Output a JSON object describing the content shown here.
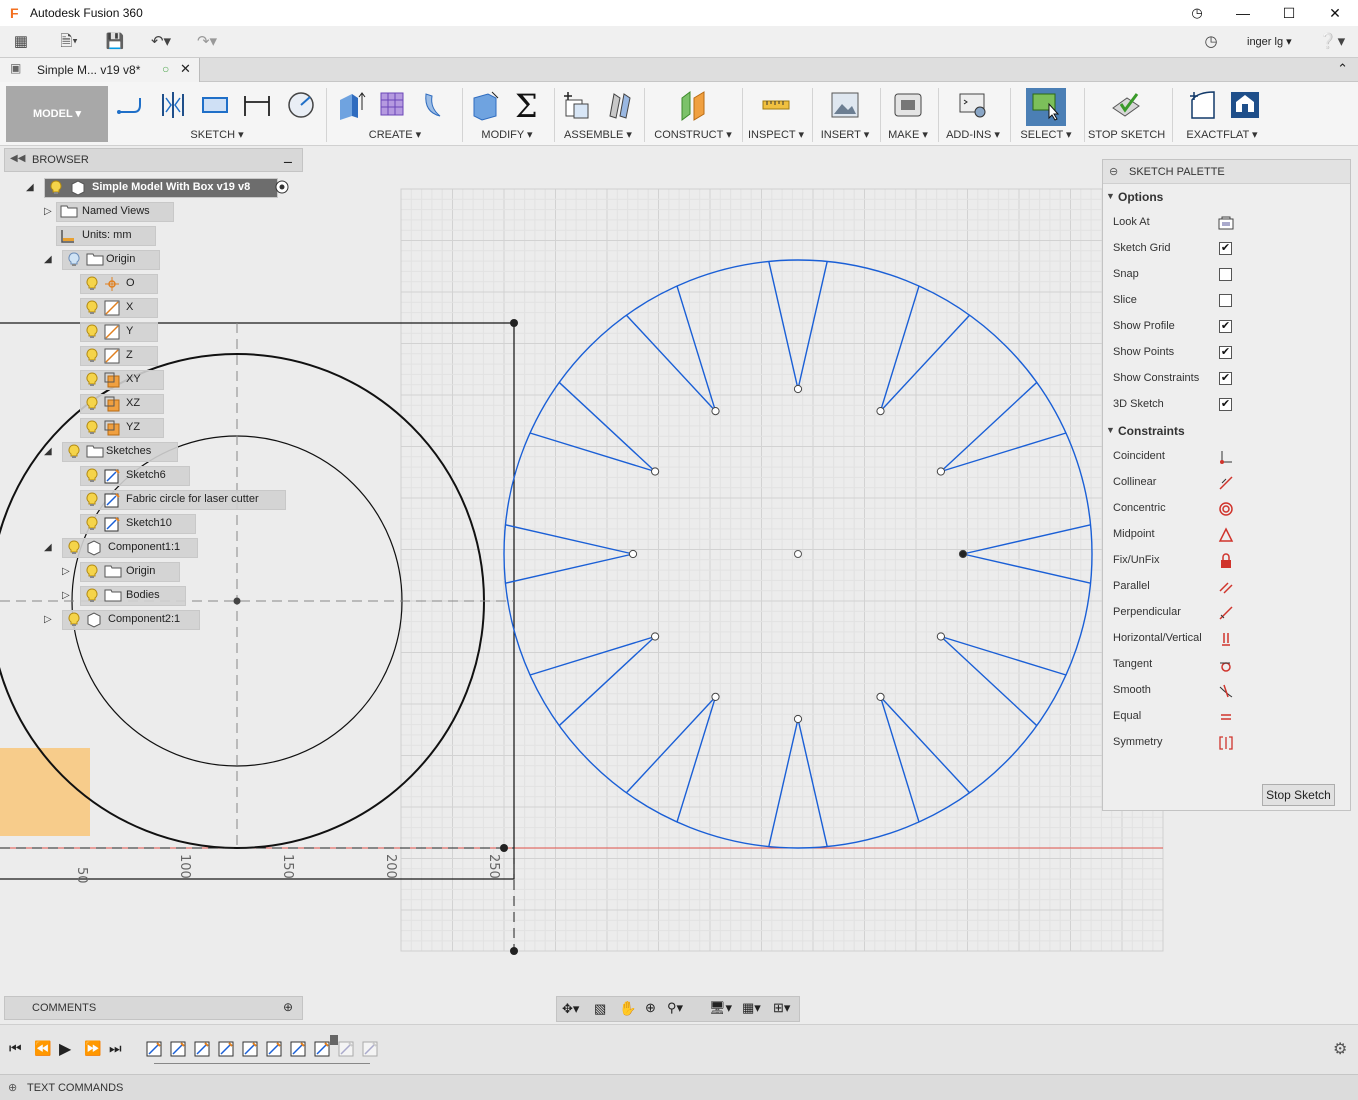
{
  "app": {
    "title": "Autodesk Fusion 360",
    "user": "inger lg"
  },
  "document_tab": {
    "label": "Simple M... v19 v8*"
  },
  "toolbar": {
    "workspace": "MODEL",
    "groups": [
      {
        "label": "SKETCH"
      },
      {
        "label": "CREATE"
      },
      {
        "label": "MODIFY"
      },
      {
        "label": "ASSEMBLE"
      },
      {
        "label": "CONSTRUCT"
      },
      {
        "label": "INSPECT"
      },
      {
        "label": "INSERT"
      },
      {
        "label": "MAKE"
      },
      {
        "label": "ADD-INS"
      },
      {
        "label": "SELECT"
      },
      {
        "label": "STOP SKETCH"
      },
      {
        "label": "EXACTFLAT"
      }
    ]
  },
  "browser": {
    "header": "BROWSER",
    "items": [
      {
        "label": "Simple Model With Box v19 v8"
      },
      {
        "label": "Named Views"
      },
      {
        "label": "Units: mm"
      },
      {
        "label": "Origin"
      },
      {
        "label": "O"
      },
      {
        "label": "X"
      },
      {
        "label": "Y"
      },
      {
        "label": "Z"
      },
      {
        "label": "XY"
      },
      {
        "label": "XZ"
      },
      {
        "label": "YZ"
      },
      {
        "label": "Sketches"
      },
      {
        "label": "Sketch6"
      },
      {
        "label": "Fabric circle for laser cutter"
      },
      {
        "label": "Sketch10"
      },
      {
        "label": "Component1:1"
      },
      {
        "label": "Origin"
      },
      {
        "label": "Bodies"
      },
      {
        "label": "Component2:1"
      }
    ]
  },
  "axis_labels": {
    "a": "50",
    "b": "100",
    "c": "150",
    "d": "200",
    "e": "250"
  },
  "palette": {
    "header": "SKETCH PALETTE",
    "options_title": "Options",
    "options": [
      {
        "label": "Look At"
      },
      {
        "label": "Sketch Grid",
        "checked": true
      },
      {
        "label": "Snap",
        "checked": false
      },
      {
        "label": "Slice",
        "checked": false
      },
      {
        "label": "Show Profile",
        "checked": true
      },
      {
        "label": "Show Points",
        "checked": true
      },
      {
        "label": "Show Constraints",
        "checked": true
      },
      {
        "label": "3D Sketch",
        "checked": true
      }
    ],
    "constraints_title": "Constraints",
    "constraints": [
      {
        "label": "Coincident"
      },
      {
        "label": "Collinear"
      },
      {
        "label": "Concentric"
      },
      {
        "label": "Midpoint"
      },
      {
        "label": "Fix/UnFix"
      },
      {
        "label": "Parallel"
      },
      {
        "label": "Perpendicular"
      },
      {
        "label": "Horizontal/Vertical"
      },
      {
        "label": "Tangent"
      },
      {
        "label": "Smooth"
      },
      {
        "label": "Equal"
      },
      {
        "label": "Symmetry"
      }
    ],
    "stop_button": "Stop Sketch"
  },
  "comments": {
    "label": "COMMENTS"
  },
  "text_commands": {
    "label": "TEXT COMMANDS"
  },
  "colors": {
    "sketch_blue": "#1a5fd6",
    "accent_select": "#4b7fb5",
    "constraint_red": "#d0342c"
  }
}
